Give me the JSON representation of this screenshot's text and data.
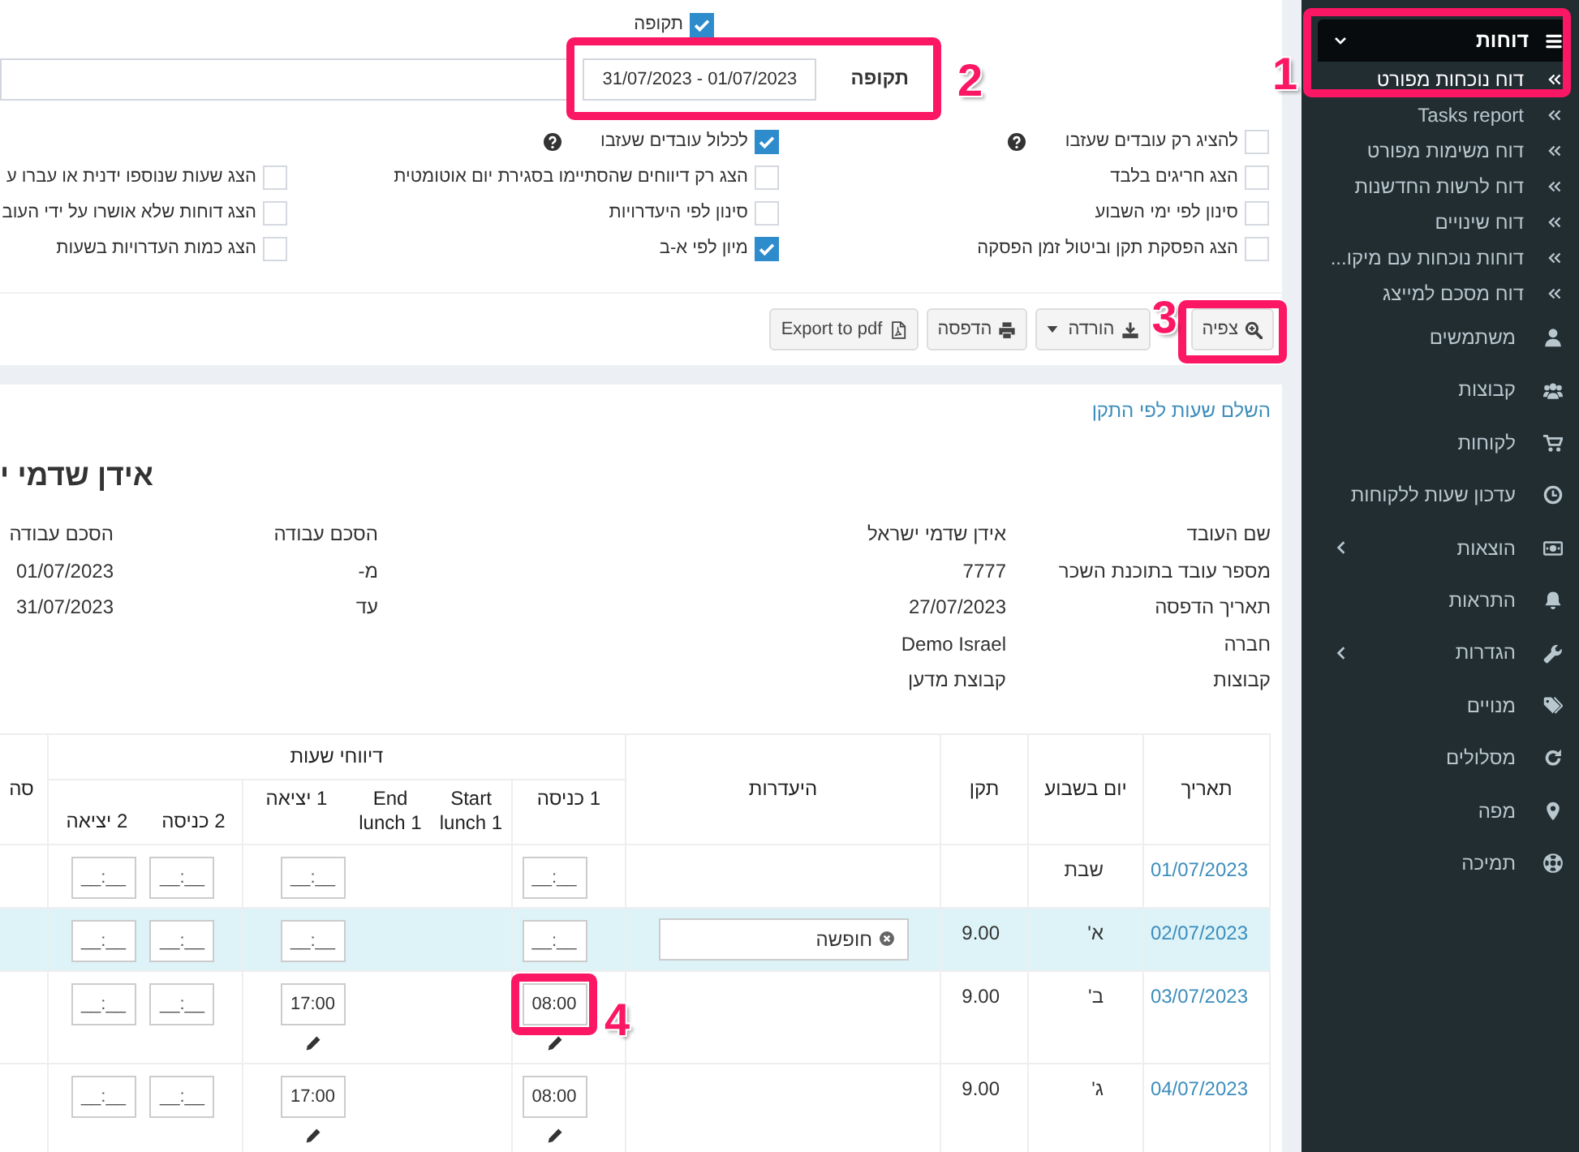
{
  "sidebar": {
    "header": {
      "label": "דוחות",
      "expanded": true,
      "callout": "1"
    },
    "subitems": [
      {
        "label": "דוח נוכחות מפורט",
        "selected": true
      },
      {
        "label": "Tasks report",
        "selected": false
      },
      {
        "label": "דוח משימות מפורט",
        "selected": false
      },
      {
        "label": "דוח לרשות החדשנות",
        "selected": false
      },
      {
        "label": "דוח שינויים",
        "selected": false
      },
      {
        "label": "דוחות נוכחות עם מיקו...",
        "selected": false
      },
      {
        "label": "דוח מסכם למייצג",
        "selected": false
      }
    ],
    "items": [
      {
        "label": "משתמשים",
        "submenu": false
      },
      {
        "label": "קבוצות",
        "submenu": false
      },
      {
        "label": "לקוחות",
        "submenu": false
      },
      {
        "label": "עדכון שעות ללקוחות",
        "submenu": false
      },
      {
        "label": "הוצאות",
        "submenu": true
      },
      {
        "label": "התראות",
        "submenu": false
      },
      {
        "label": "הגדרות",
        "submenu": true
      },
      {
        "label": "מנויים",
        "submenu": false
      },
      {
        "label": "מסלולים",
        "submenu": false
      },
      {
        "label": "מפה",
        "submenu": false
      },
      {
        "label": "תמיכה",
        "submenu": false
      }
    ]
  },
  "filters": {
    "period_toggle": {
      "label": "תקופה",
      "checked": true
    },
    "period": {
      "label": "תקופה",
      "value": "01/07/2023 - 31/07/2023",
      "callout": "2"
    },
    "option_columns": [
      {
        "items": [
          {
            "label": "להציג רק עובדים שעזבו",
            "checked": false,
            "help": true
          },
          {
            "label": "הצג חריגים בלבד",
            "checked": false,
            "help": false
          },
          {
            "label": "סינון לפי ימי השבוע",
            "checked": false,
            "help": false
          },
          {
            "label": "הצג הפסקת תקן וביטול זמן הפסקה",
            "checked": false,
            "help": false
          }
        ]
      },
      {
        "items": [
          {
            "label": "לכלול עובדים שעזבו",
            "checked": true,
            "help": true
          },
          {
            "label": "הצג רק דיווחים שהסתיימו בסגירת יום אוטומטית",
            "checked": false,
            "help": false
          },
          {
            "label": "סינון לפי היעדרויות",
            "checked": false,
            "help": false
          },
          {
            "label": "מיון לפי א-ב",
            "checked": true,
            "help": false
          }
        ]
      },
      {
        "items": [
          {
            "label": "הצג שעות שנוספו ידנית או עברו ע",
            "checked": false,
            "help": false
          },
          {
            "label": "הצג דוחות שלא אושרו על ידי העוב",
            "checked": false,
            "help": false
          },
          {
            "label": "הצג כמות העדרויות בשעות",
            "checked": false,
            "help": false
          }
        ]
      }
    ]
  },
  "toolbar": [
    {
      "label": "צפיה",
      "dropdown": false,
      "callout": "3"
    },
    {
      "label": "הורדה",
      "dropdown": true
    },
    {
      "label": "הדפסה",
      "dropdown": false
    },
    {
      "label": "Export to pdf",
      "dropdown": false
    }
  ],
  "report": {
    "link": "השלם שעות לפי התקן",
    "title": "אידן שדמי י",
    "details": [
      {
        "label": "שם העובד",
        "value": "אידן שדמי ישראל"
      },
      {
        "label": "מספר עובד בתוכנת השכר",
        "value": "7777"
      },
      {
        "label": "תאריך הדפסה",
        "value": "27/07/2023"
      },
      {
        "label": "חברה",
        "value": "Demo Israel"
      },
      {
        "label": "קבוצות",
        "value": "קבוצת מדען"
      }
    ],
    "agreement": [
      {
        "label": "הסכם עבודה",
        "value": "הסכם עבודה"
      },
      {
        "label": "מ-",
        "value": "01/07/2023"
      },
      {
        "label": "עד",
        "value": "31/07/2023"
      }
    ]
  },
  "table": {
    "columns": [
      {
        "label": "תאריך"
      },
      {
        "label": "יום בשבוע"
      },
      {
        "label": "תקן"
      },
      {
        "label": "היעדרות"
      }
    ],
    "group": {
      "label": "דיווחי שעות",
      "columns": [
        {
          "label": "1 כניסה",
          "kind": "time"
        },
        {
          "label": "Start lunch 1",
          "kind": "lunch"
        },
        {
          "label": "End lunch 1",
          "kind": "lunch"
        },
        {
          "label": "1 יציאה",
          "kind": "time"
        },
        {
          "label": "2 כניסה",
          "kind": "time"
        },
        {
          "label": "2 יציאה",
          "kind": "time"
        }
      ]
    },
    "column_last": "סה",
    "rows": [
      {
        "date": "01/07/2023",
        "weekday": "שבת",
        "highlighted": false,
        "times": [
          {
            "placeholder": "__:__",
            "edited": false
          },
          {
            "placeholder": "__:__",
            "edited": false
          },
          {
            "placeholder": "__:__",
            "edited": false
          },
          {
            "placeholder": "__:__",
            "edited": false
          }
        ]
      },
      {
        "date": "02/07/2023",
        "weekday": "א'",
        "standard": "9.00",
        "absence": "חופשה",
        "highlighted": true,
        "times": [
          {
            "placeholder": "__:__",
            "edited": false
          },
          {
            "placeholder": "__:__",
            "edited": false
          },
          {
            "placeholder": "__:__",
            "edited": false
          },
          {
            "placeholder": "__:__",
            "edited": false
          }
        ]
      },
      {
        "date": "03/07/2023",
        "weekday": "ב'",
        "standard": "9.00",
        "highlighted": false,
        "times": [
          {
            "value": "08:00",
            "edited": true,
            "callout": "4"
          },
          {
            "value": "17:00",
            "edited": true
          },
          {
            "placeholder": "__:__",
            "edited": false
          },
          {
            "placeholder": "__:__",
            "edited": false
          }
        ]
      },
      {
        "date": "04/07/2023",
        "weekday": "ג'",
        "standard": "9.00",
        "highlighted": false,
        "times": [
          {
            "value": "08:00",
            "edited": true
          },
          {
            "value": "17:00",
            "edited": true
          },
          {
            "placeholder": "__:__",
            "edited": false
          },
          {
            "placeholder": "__:__",
            "edited": false
          }
        ]
      }
    ]
  }
}
